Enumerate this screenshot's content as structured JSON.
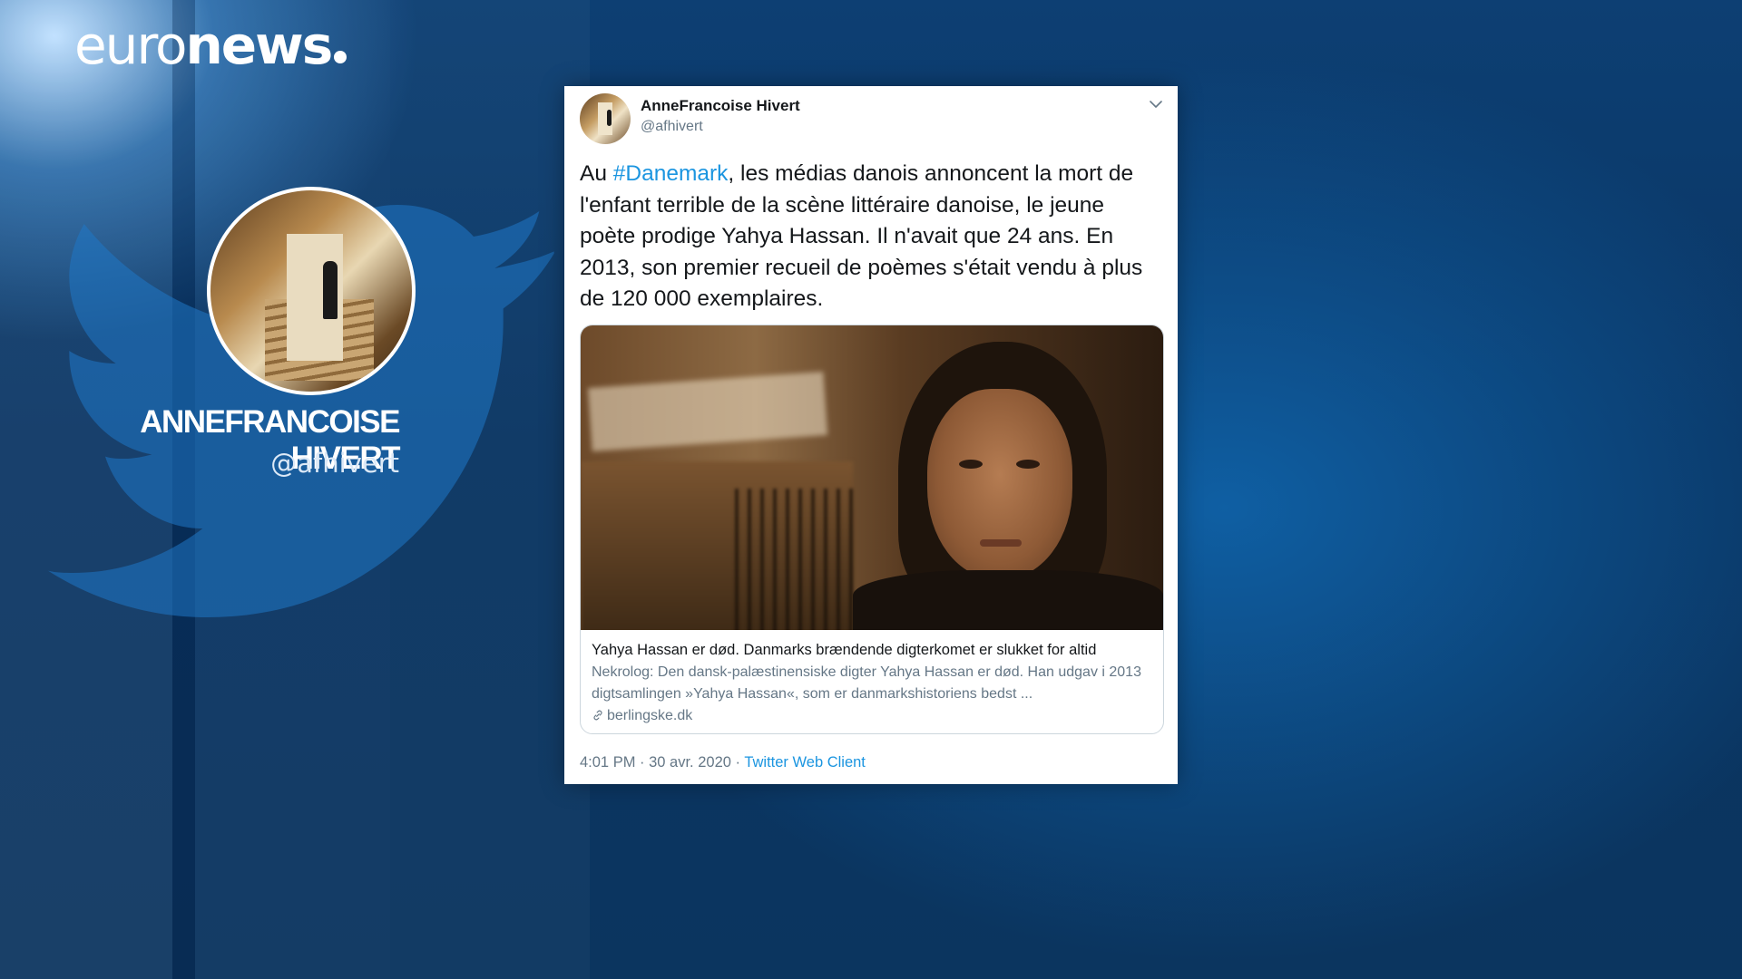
{
  "broadcaster": {
    "logo_light": "euro",
    "logo_bold": "news"
  },
  "profile": {
    "display_name": "ANNEFRANCOISE HIVERT",
    "handle": "@afhivert"
  },
  "tweet": {
    "author_name": "AnneFrancoise Hivert",
    "author_handle": "@afhivert",
    "text_before": "Au ",
    "hashtag": "#Danemark",
    "text_after": ", les médias danois annoncent la mort de l'enfant terrible de la scène littéraire danoise, le jeune poète prodige Yahya Hassan. Il n'avait que 24 ans. En 2013, son premier recueil de poèmes s'était vendu à plus de 120 000 exemplaires.",
    "link_card": {
      "title": "Yahya Hassan er død. Danmarks brændende digterkomet er slukket for altid",
      "description": "Nekrolog: Den dansk-palæstinensiske digter Yahya Hassan er død. Han udgav i 2013 digtsamlingen »Yahya Hassan«, som er danmarkshistoriens bedst ...",
      "domain": "berlingske.dk"
    },
    "timestamp": "4:01 PM · 30 avr. 2020 · ",
    "source": "Twitter Web Client"
  },
  "colors": {
    "background": "#0b3a6a",
    "hashtag_blue": "#1b95e0",
    "secondary_text": "#657786"
  },
  "icons": [
    "twitter-bird-icon",
    "chevron-down-icon",
    "link-icon"
  ]
}
